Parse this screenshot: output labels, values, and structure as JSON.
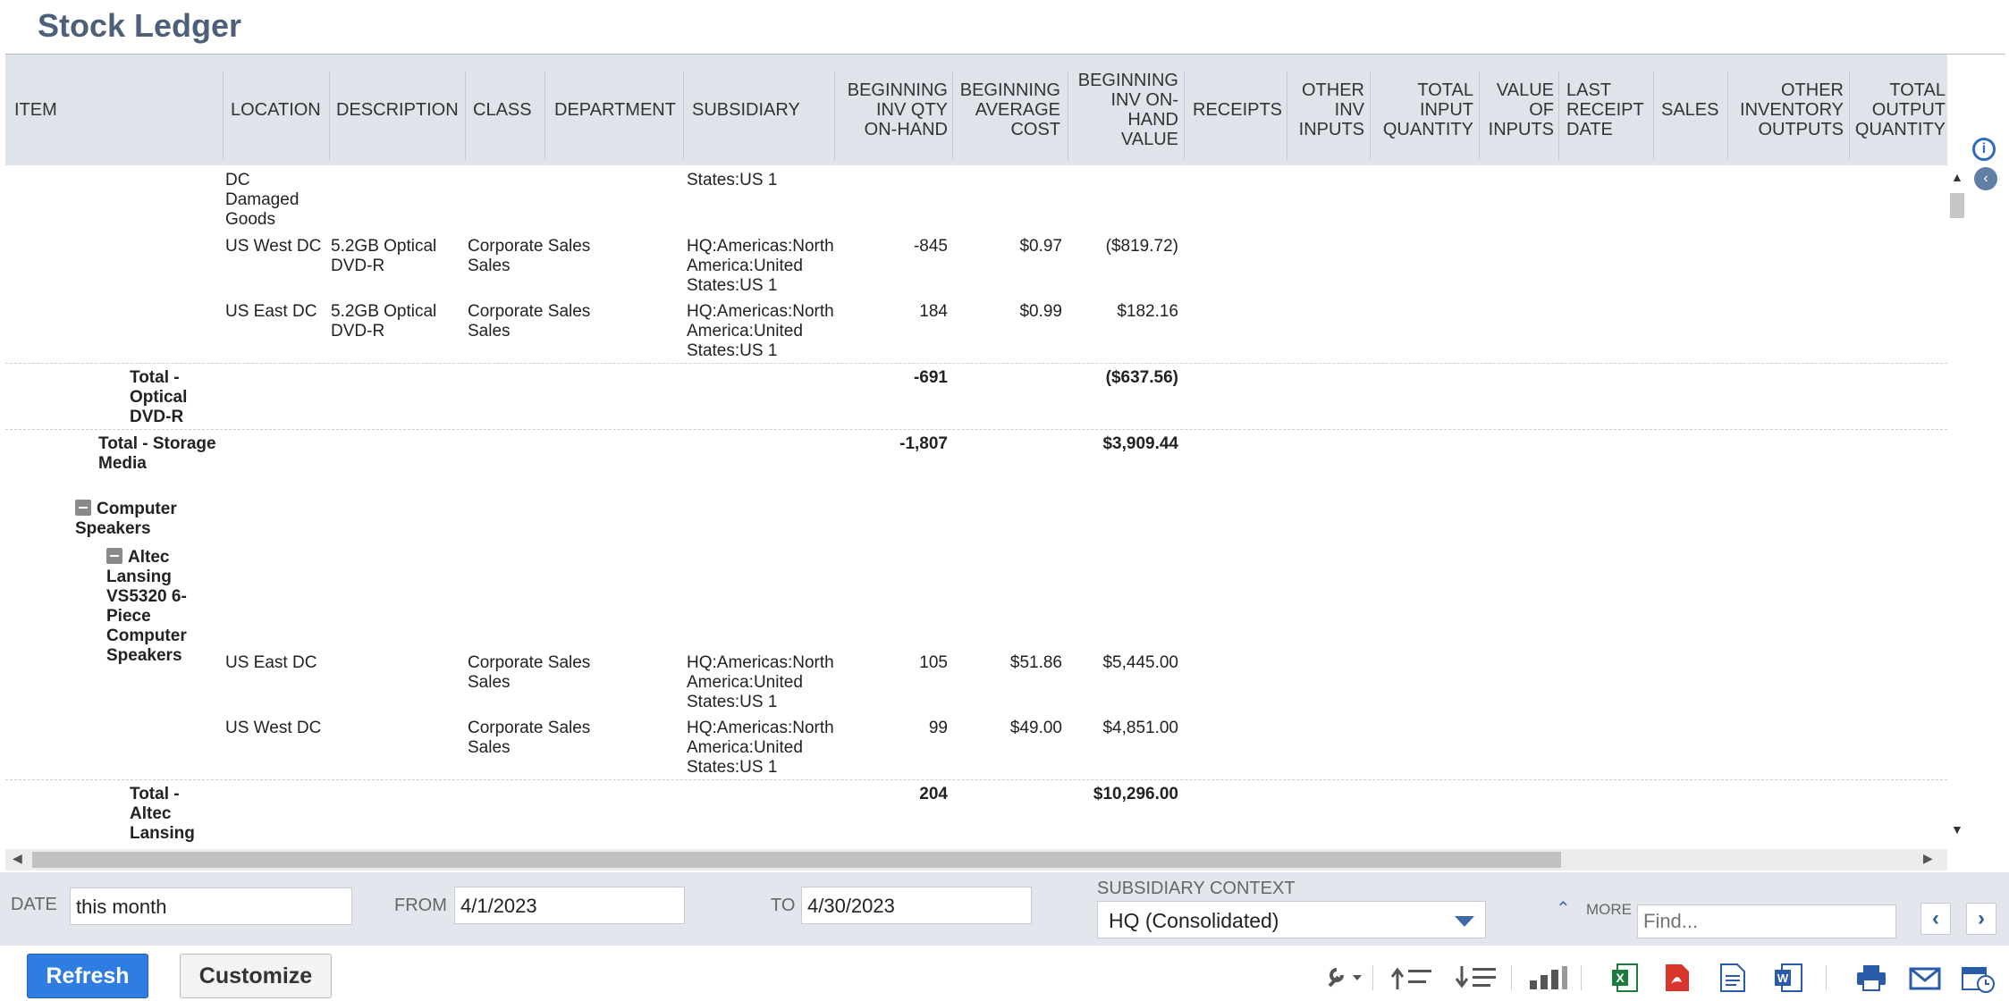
{
  "page": {
    "title": "Stock Ledger"
  },
  "columns": [
    "ITEM",
    "LOCATION",
    "DESCRIPTION",
    "CLASS",
    "DEPARTMENT",
    "SUBSIDIARY",
    "BEGINNING INV QTY ON-HAND",
    "BEGINNING AVERAGE COST",
    "BEGINNING INV ON-HAND VALUE",
    "RECEIPTS",
    "OTHER INV INPUTS",
    "TOTAL INPUT QUANTITY",
    "VALUE OF INPUTS",
    "LAST RECEIPT DATE",
    "SALES",
    "OTHER INVENTORY OUTPUTS",
    "TOTAL OUTPUT QUANTITY"
  ],
  "rows": [
    {
      "location": "DC Damaged Goods",
      "subsidiary": "States:US 1"
    },
    {
      "location": "US West DC",
      "description": "5.2GB Optical DVD-R",
      "class": "Corporate Sales Sales",
      "subsidiary": "HQ:Americas:North America:United States:US 1",
      "qty": "-845",
      "avg_cost": "$0.97",
      "value": "($819.72)"
    },
    {
      "location": "US East DC",
      "description": "5.2GB Optical DVD-R",
      "class": "Corporate Sales Sales",
      "subsidiary": "HQ:Americas:North America:United States:US 1",
      "qty": "184",
      "avg_cost": "$0.99",
      "value": "$182.16"
    },
    {
      "item": "Total - Optical DVD-R",
      "qty": "-691",
      "value": "($637.56)"
    },
    {
      "item": "Total - Storage Media",
      "qty": "-1,807",
      "value": "$3,909.44"
    },
    {
      "item": "Computer Speakers"
    },
    {
      "item": "Altec Lansing VS5320 6-Piece Computer Speakers"
    },
    {
      "location": "US East DC",
      "class": "Corporate Sales Sales",
      "subsidiary": "HQ:Americas:North America:United States:US 1",
      "qty": "105",
      "avg_cost": "$51.86",
      "value": "$5,445.00"
    },
    {
      "location": "US West DC",
      "class": "Corporate Sales Sales",
      "subsidiary": "HQ:Americas:North America:United States:US 1",
      "qty": "99",
      "avg_cost": "$49.00",
      "value": "$4,851.00"
    },
    {
      "item": "Total - Altec Lansing",
      "qty": "204",
      "value": "$10,296.00"
    }
  ],
  "filters": {
    "date_label": "DATE",
    "date_value": "this month",
    "from_label": "FROM",
    "from_value": "4/1/2023",
    "to_label": "TO",
    "to_value": "4/30/2023",
    "subsidiary_label": "SUBSIDIARY CONTEXT",
    "subsidiary_value": "HQ (Consolidated)",
    "more_label": "MORE",
    "find_placeholder": "Find..."
  },
  "toolbar": {
    "refresh_label": "Refresh",
    "customize_label": "Customize"
  },
  "colors": {
    "accent": "#2f7de1",
    "header_bg": "#dfe4eb",
    "title": "#4d5f79",
    "excel": "#1d7a3e",
    "pdf": "#d9352c",
    "word": "#2a5ba8"
  }
}
